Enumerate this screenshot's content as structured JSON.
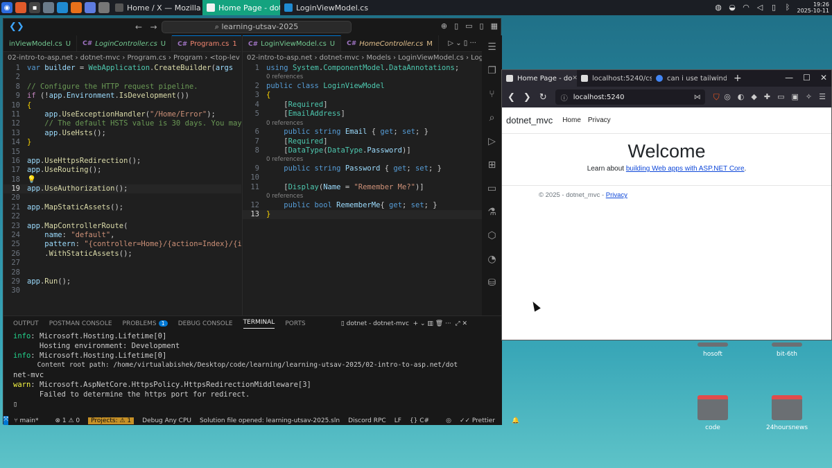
{
  "taskbar": {
    "tasks": [
      {
        "label": "Home / X — Mozilla Fir..."
      },
      {
        "label": "Home Page - dotnet_m..."
      },
      {
        "label": "LoginViewModel.cs - le..."
      }
    ],
    "clock_time": "19:26",
    "clock_date": "2025-10-11"
  },
  "desktop": {
    "icons": [
      {
        "label": "hosoft"
      },
      {
        "label": "bit-6th"
      },
      {
        "label": "code"
      },
      {
        "label": "24hoursnews"
      }
    ]
  },
  "vscode": {
    "search": "learning-utsav-2025",
    "left_tabs": [
      {
        "name": "inViewModel.cs",
        "status": "U"
      },
      {
        "name": "LoginController.cs",
        "status": "U"
      },
      {
        "name": "Program.cs",
        "status": "1"
      }
    ],
    "right_tabs": [
      {
        "name": "LoginViewModel.cs",
        "status": "U"
      },
      {
        "name": "HomeController.cs",
        "status": "M"
      }
    ],
    "left_breadcrumb": "02-intro-to-asp.net  ›  dotnet-mvc  ›  Program.cs  ›  Program  ›  <top-lev",
    "right_breadcrumb": "02-intro-to-asp.net  ›  dotnet-mvc  ›  Models  ›  LoginViewModel.cs  ›  Login",
    "references_label": "0 references",
    "panel_tabs": [
      "OUTPUT",
      "POSTMAN CONSOLE",
      "PROBLEMS",
      "DEBUG CONSOLE",
      "TERMINAL",
      "PORTS"
    ],
    "problems_count": "1",
    "terminal_name": "dotnet - dotnet-mvc",
    "terminal": {
      "info1_prefix": "info",
      "info1_text": ": Microsoft.Hosting.Lifetime[0]",
      "line2": "      Hosting environment: Development",
      "info2_prefix": "info",
      "info2_text": ": Microsoft.Hosting.Lifetime[0]",
      "line4": "      Content root path: /home/virtualabishek/Desktop/code/learning/learning-utsav-2025/02-intro-to-asp.net/dot",
      "line5": "net-mvc",
      "warn_prefix": "warn",
      "warn_text": ": Microsoft.AspNetCore.HttpsPolicy.HttpsRedirectionMiddleware[3]",
      "line7": "      Failed to determine the https port for redirect."
    },
    "status": {
      "branch": "main*",
      "problems": "⊗ 1 ⚠ 0",
      "projects": "Projects: ⚠ 1",
      "debug": "Debug Any CPU",
      "solution": "Solution file opened: learning-utsav-2025.sln",
      "discord": "Discord RPC",
      "eol": "LF",
      "lang": "C#",
      "prettier": "Prettier"
    }
  },
  "browser": {
    "tabs": [
      {
        "label": "Home Page - do"
      },
      {
        "label": "localhost:5240/css/"
      },
      {
        "label": "can i use tailwindcs"
      }
    ],
    "url": "localhost:5240",
    "site": {
      "brand": "dotnet_mvc",
      "nav_home": "Home",
      "nav_privacy": "Privacy",
      "heading": "Welcome",
      "lead_prefix": "Learn about ",
      "lead_link": "building Web apps with ASP.NET Core",
      "lead_suffix": ".",
      "footer_prefix": "© 2025 - dotnet_mvc - ",
      "footer_link": "Privacy"
    }
  },
  "colors": {
    "accent": "#0078d4",
    "active_task": "#14a37f",
    "vscode_bg": "#1f1f1f"
  }
}
